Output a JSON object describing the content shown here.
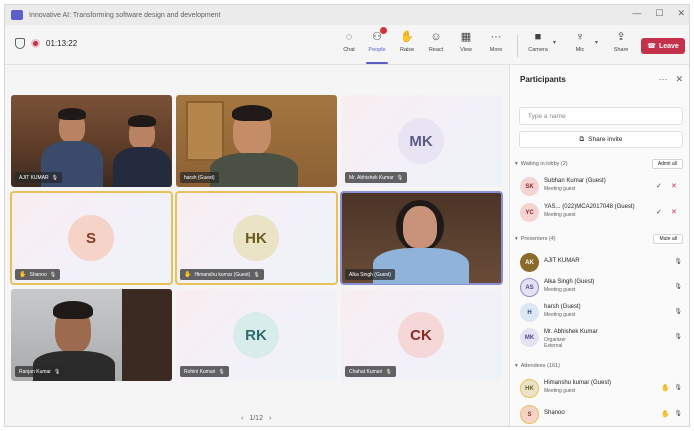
{
  "window": {
    "title": "Innovative AI: Transforming software design and development",
    "controls": [
      "—",
      "☐",
      "✕"
    ]
  },
  "toolbar": {
    "timer": "01:13:22",
    "buttons": [
      {
        "label": "Chat",
        "icon": "chat-icon",
        "glyph": "◌"
      },
      {
        "label": "People",
        "icon": "people-icon",
        "glyph": "⚇",
        "active": true,
        "badge": true
      },
      {
        "label": "Raise",
        "icon": "raise-hand-icon",
        "glyph": "✋"
      },
      {
        "label": "React",
        "icon": "react-icon",
        "glyph": "☺"
      },
      {
        "label": "View",
        "icon": "view-icon",
        "glyph": "▦"
      },
      {
        "label": "More",
        "icon": "more-icon",
        "glyph": "···"
      }
    ],
    "devices": [
      {
        "label": "Camera",
        "icon": "camera-icon",
        "glyph": "■"
      },
      {
        "label": "Mic",
        "icon": "mic-icon",
        "glyph": "♆"
      },
      {
        "label": "Share",
        "icon": "share-icon",
        "glyph": "⇪"
      }
    ],
    "leave_label": "Leave",
    "leave_color": "#c4314b"
  },
  "stage": {
    "tiles": [
      {
        "name": "AJIT KUMAR",
        "type": "video",
        "scene": "two-men"
      },
      {
        "name": "harsh (Guest)",
        "type": "video",
        "scene": "one-man"
      },
      {
        "name": "Mr. Abhishek Kumar",
        "type": "avatar",
        "initials": "MK",
        "bg": "#e8e4f3",
        "fg": "#5b5a8a"
      },
      {
        "name": "Shanoo",
        "type": "avatar",
        "initials": "S",
        "bg": "#f6d3c8",
        "fg": "#8a3a22",
        "hand": true,
        "speaking": true
      },
      {
        "name": "Himanshu kumar (Guest)",
        "type": "avatar",
        "initials": "HK",
        "bg": "#eae3c6",
        "fg": "#6b5a20",
        "hand": true,
        "speaking": true
      },
      {
        "name": "Alka Singh (Guest)",
        "type": "video",
        "scene": "woman",
        "selected": true
      },
      {
        "name": "Ranjan Kumar",
        "type": "video",
        "scene": "young-man"
      },
      {
        "name": "Rohini Kumari",
        "type": "avatar",
        "initials": "RK",
        "bg": "#d9ecec",
        "fg": "#2f6b6b"
      },
      {
        "name": "Chahat Kumari",
        "type": "avatar",
        "initials": "CK",
        "bg": "#f6d7d7",
        "fg": "#8a2a2a"
      }
    ],
    "pager": {
      "prev": "‹",
      "label": "1/12",
      "next": "›"
    }
  },
  "panel": {
    "title": "Participants",
    "search_placeholder": "Type a name",
    "share_invite": "Share invite",
    "lobby": {
      "header": "Waiting in lobby (2)",
      "action": "Admit all",
      "people": [
        {
          "initials": "SK",
          "name": "Subhan Kumar (Guest)",
          "role": "Meeting guest",
          "bg": "#f6d3d3",
          "fg": "#8a2a2a"
        },
        {
          "initials": "YC",
          "name": "YAS... (022)MCA2017048 (Guest)",
          "role": "Meeting guest",
          "bg": "#f6d3d3",
          "fg": "#8a2a2a"
        }
      ]
    },
    "presenters": {
      "header": "Presenters (4)",
      "action": "Mute all",
      "people": [
        {
          "initials": "AK",
          "name": "AJIT KUMAR",
          "role": "",
          "bg": "#8a6a2a",
          "fg": "#ffffff",
          "photo": true
        },
        {
          "initials": "AS",
          "name": "Alka Singh (Guest)",
          "role": "Meeting guest",
          "bg": "#e6e2f3",
          "fg": "#4b4a8a"
        },
        {
          "initials": "H",
          "name": "harsh (Guest)",
          "role": "Meeting guest",
          "bg": "#dde6f3",
          "fg": "#2b4a8a"
        },
        {
          "initials": "MK",
          "name": "Mr. Abhishek Kumar",
          "role": "Organizer\nExternal",
          "bg": "#e6e2f3",
          "fg": "#4b4a8a"
        }
      ]
    },
    "attendees": {
      "header": "Attendees (161)",
      "people": [
        {
          "initials": "HK",
          "name": "Himanshu kumar (Guest)",
          "role": "Meeting guest",
          "bg": "#eae3c6",
          "fg": "#6b5a20",
          "hand": true
        },
        {
          "initials": "S",
          "name": "Shanoo",
          "role": "",
          "bg": "#f6d3c8",
          "fg": "#8a3a22",
          "hand": true
        }
      ]
    }
  }
}
